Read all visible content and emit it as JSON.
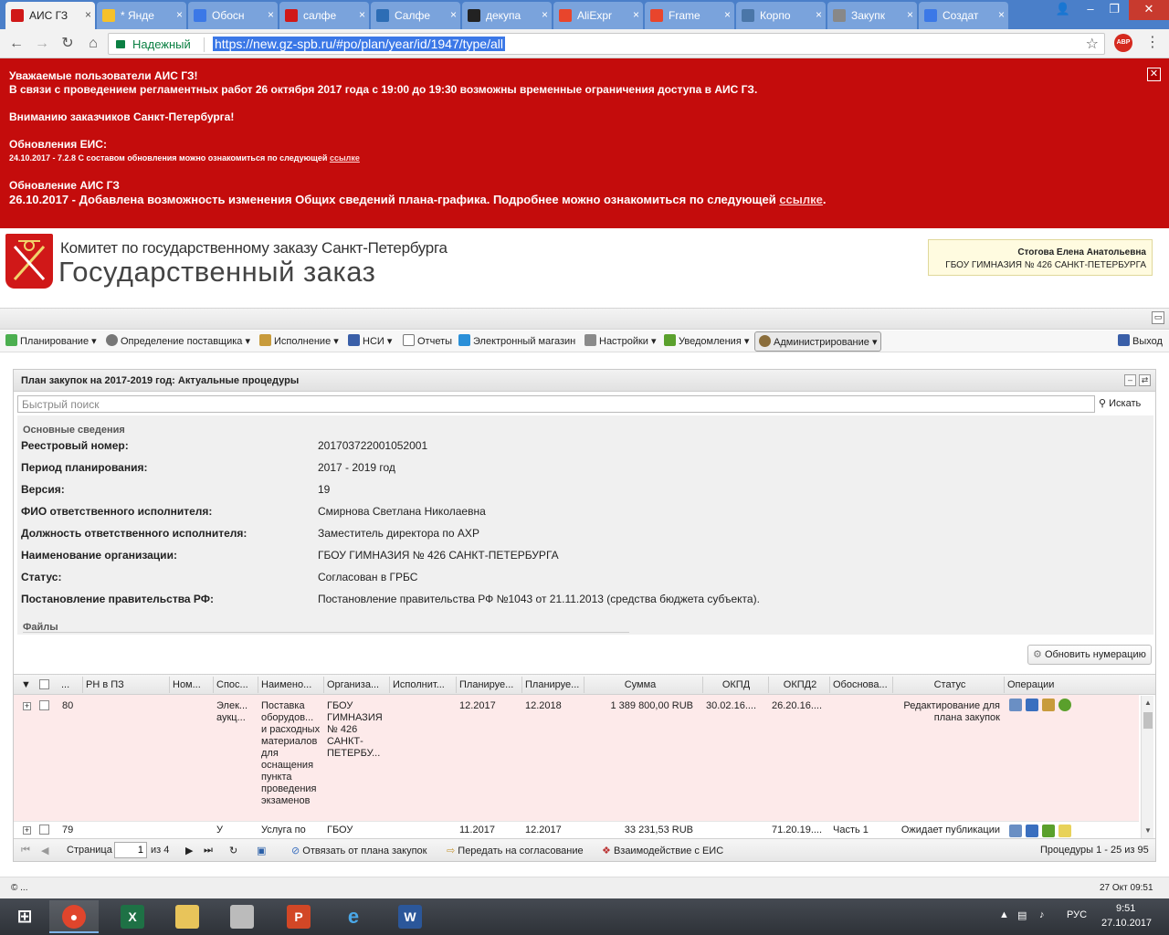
{
  "browser": {
    "tabs": [
      {
        "title": "АИС ГЗ",
        "color": "#d01818",
        "active": true
      },
      {
        "title": "* Янде",
        "color": "#f6c12a",
        "active": false
      },
      {
        "title": "Обосн",
        "color": "#3b78e7",
        "active": false
      },
      {
        "title": "салфе",
        "color": "#d01818",
        "active": false
      },
      {
        "title": "Салфе",
        "color": "#2d6db5",
        "active": false
      },
      {
        "title": "декупа",
        "color": "#222222",
        "active": false
      },
      {
        "title": "AliExpr",
        "color": "#e8452c",
        "active": false
      },
      {
        "title": "Frame",
        "color": "#e8452c",
        "active": false
      },
      {
        "title": "Корпо",
        "color": "#4a76a8",
        "active": false
      },
      {
        "title": "Закупк",
        "color": "#888888",
        "active": false
      },
      {
        "title": "Создат",
        "color": "#3b78e7",
        "active": false
      }
    ],
    "secure_label": "Надежный",
    "url": "https://new.gz-spb.ru/#po/plan/year/id/1947/type/all",
    "abp_label": "ABP"
  },
  "banner": {
    "line1": "Уважаемые пользователи АИС ГЗ!",
    "line2": "В связи с проведением регламентных работ 26 октября 2017 года с 19:00 до 19:30 возможны временные ограничения доступа в АИС ГЗ.",
    "line3": "Вниманию заказчиков Санкт-Петербурга!",
    "eis_title": "Обновления ЕИС:",
    "eis_text": "24.10.2017 - 7.2.8 С составом обновления можно ознакомиться по следующей",
    "eis_link": "ссылке",
    "ais_title": "Обновление АИС ГЗ",
    "ais_text": "26.10.2017 - Добавлена возможность изменения Общих сведений плана-графика. Подробнее можно ознакомиться по следующей",
    "ais_link": "ссылке",
    "ais_end": "."
  },
  "header": {
    "org_line1": "Комитет по государственному заказу Санкт-Петербурга",
    "org_line2": "Государственный заказ",
    "user_name": "Стогова Елена Анатольевна",
    "user_org": "ГБОУ ГИМНАЗИЯ № 426 САНКТ-ПЕТЕРБУРГА"
  },
  "menu": {
    "planning": "Планирование",
    "supplier": "Определение поставщика",
    "execution": "Исполнение",
    "nsi": "НСИ",
    "reports": "Отчеты",
    "eshop": "Электронный магазин",
    "settings": "Настройки",
    "notifications": "Уведомления",
    "admin": "Администрирование",
    "exit": "Выход"
  },
  "panel": {
    "title": "План закупок на 2017-2019 год: Актуальные процедуры",
    "search_placeholder": "Быстрый поиск",
    "search_button": "Искать",
    "info_legend": "Основные сведения",
    "files_legend": "Файлы",
    "renumber_button": "Обновить нумерацию",
    "info": [
      {
        "label": "Реестровый номер:",
        "value": "201703722001052001"
      },
      {
        "label": "Период планирования:",
        "value": "2017 - 2019 год"
      },
      {
        "label": "Версия:",
        "value": "19"
      },
      {
        "label": "ФИО ответственного исполнителя:",
        "value": "Смирнова Светлана Николаевна"
      },
      {
        "label": "Должность ответственного исполнителя:",
        "value": "Заместитель директора по АХР"
      },
      {
        "label": "Наименование организации:",
        "value": "ГБОУ ГИМНАЗИЯ № 426 САНКТ-ПЕТЕРБУРГА"
      },
      {
        "label": "Статус:",
        "value": "Согласован в ГРБС"
      },
      {
        "label": "Постановление правительства РФ:",
        "value": "Постановление правительства РФ №1043 от 21.11.2013 (средства бюджета субъекта)."
      }
    ]
  },
  "grid": {
    "columns": [
      "...",
      "РН в ПЗ",
      "Ном...",
      "Спос...",
      "Наимено...",
      "Организа...",
      "Исполнит...",
      "Планируе...",
      "Планируе...",
      "Сумма",
      "ОКПД",
      "ОКПД2",
      "Обоснова...",
      "Статус",
      "Операции"
    ],
    "rows": [
      {
        "num": "80",
        "method": "Элек... аукц...",
        "name": "Поставка оборудов... и расходных материалов для оснащения пункта проведения экзаменов",
        "org": "ГБОУ ГИМНАЗИЯ № 426 САНКТ-ПЕТЕРБУ...",
        "plan1": "12.2017",
        "plan2": "12.2018",
        "sum": "1 389 800,00 RUB",
        "okpd": "30.02.16....",
        "okpd2": "26.20.16....",
        "basis": "",
        "status": "Редактирование для плана закупок"
      },
      {
        "num": "79",
        "method": "У",
        "name": "Услуга по",
        "org": "ГБОУ",
        "plan1": "11.2017",
        "plan2": "12.2017",
        "sum": "33 231,53 RUB",
        "okpd": "",
        "okpd2": "71.20.19....",
        "basis": "Часть 1",
        "status": "Ожидает публикации"
      }
    ]
  },
  "pager": {
    "page_label": "Страница",
    "page_value": "1",
    "of_label": "из 4",
    "unbind": "Отвязать от плана закупок",
    "send": "Передать на согласование",
    "eis": "Взаимодействие с ЕИС",
    "summary": "Процедуры 1 - 25 из 95"
  },
  "footer": {
    "left": "© ...",
    "right": "27 Окт 09:51"
  },
  "taskbar": {
    "lang": "РУС",
    "time": "9:51",
    "date": "27.10.2017"
  }
}
